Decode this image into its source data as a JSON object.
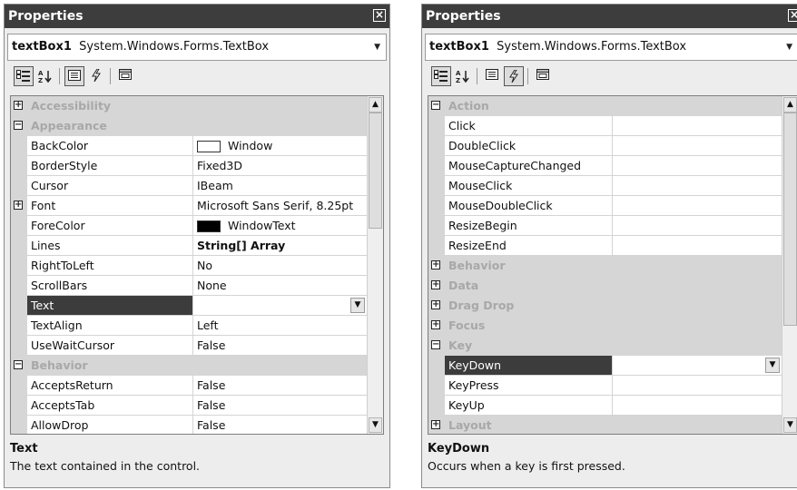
{
  "left": {
    "title": "Properties",
    "object_name": "textBox1",
    "object_type": "System.Windows.Forms.TextBox",
    "toolbar": {
      "categorized_icon": "categorized-icon",
      "alphabetical_icon": "alphabetical-icon",
      "properties_icon": "properties-icon",
      "events_icon": "events-lightning-icon",
      "property_pages_icon": "property-pages-icon",
      "active": "properties"
    },
    "rows": [
      {
        "type": "category",
        "label": "Accessibility",
        "expanded": false
      },
      {
        "type": "category",
        "label": "Appearance",
        "expanded": true
      },
      {
        "type": "property",
        "name": "BackColor",
        "value": "Window",
        "swatch": "#ffffff"
      },
      {
        "type": "property",
        "name": "BorderStyle",
        "value": "Fixed3D"
      },
      {
        "type": "property",
        "name": "Cursor",
        "value": "IBeam"
      },
      {
        "type": "property",
        "name": "Font",
        "value": "Microsoft Sans Serif, 8.25pt",
        "expandable": true
      },
      {
        "type": "property",
        "name": "ForeColor",
        "value": "WindowText",
        "swatch": "#000000"
      },
      {
        "type": "property",
        "name": "Lines",
        "value": "String[] Array",
        "bold": true
      },
      {
        "type": "property",
        "name": "RightToLeft",
        "value": "No"
      },
      {
        "type": "property",
        "name": "ScrollBars",
        "value": "None"
      },
      {
        "type": "property",
        "name": "Text",
        "value": "",
        "selected": true,
        "dropdown": true
      },
      {
        "type": "property",
        "name": "TextAlign",
        "value": "Left"
      },
      {
        "type": "property",
        "name": "UseWaitCursor",
        "value": "False"
      },
      {
        "type": "category",
        "label": "Behavior",
        "expanded": true
      },
      {
        "type": "property",
        "name": "AcceptsReturn",
        "value": "False"
      },
      {
        "type": "property",
        "name": "AcceptsTab",
        "value": "False"
      },
      {
        "type": "property",
        "name": "AllowDrop",
        "value": "False"
      }
    ],
    "scroll": {
      "thumb_top_fraction": 0.0,
      "thumb_size_fraction": 0.38
    },
    "help_title": "Text",
    "help_desc": "The text contained in the control."
  },
  "right": {
    "title": "Properties",
    "object_name": "textBox1",
    "object_type": "System.Windows.Forms.TextBox",
    "toolbar": {
      "categorized_icon": "categorized-icon",
      "alphabetical_icon": "alphabetical-icon",
      "properties_icon": "properties-icon",
      "events_icon": "events-lightning-icon",
      "property_pages_icon": "property-pages-icon",
      "active": "events"
    },
    "rows": [
      {
        "type": "category",
        "label": "Action",
        "expanded": true
      },
      {
        "type": "property",
        "name": "Click",
        "value": ""
      },
      {
        "type": "property",
        "name": "DoubleClick",
        "value": ""
      },
      {
        "type": "property",
        "name": "MouseCaptureChanged",
        "value": ""
      },
      {
        "type": "property",
        "name": "MouseClick",
        "value": ""
      },
      {
        "type": "property",
        "name": "MouseDoubleClick",
        "value": ""
      },
      {
        "type": "property",
        "name": "ResizeBegin",
        "value": ""
      },
      {
        "type": "property",
        "name": "ResizeEnd",
        "value": ""
      },
      {
        "type": "category",
        "label": "Behavior",
        "expanded": false
      },
      {
        "type": "category",
        "label": "Data",
        "expanded": false
      },
      {
        "type": "category",
        "label": "Drag Drop",
        "expanded": false
      },
      {
        "type": "category",
        "label": "Focus",
        "expanded": false
      },
      {
        "type": "category",
        "label": "Key",
        "expanded": true
      },
      {
        "type": "property",
        "name": "KeyDown",
        "value": "",
        "selected": true,
        "dropdown": true
      },
      {
        "type": "property",
        "name": "KeyPress",
        "value": ""
      },
      {
        "type": "property",
        "name": "KeyUp",
        "value": ""
      },
      {
        "type": "category",
        "label": "Layout",
        "expanded": false
      }
    ],
    "scroll": {
      "thumb_top_fraction": 0.0,
      "thumb_size_fraction": 0.7
    },
    "help_title": "KeyDown",
    "help_desc": "Occurs when a key is first pressed."
  }
}
